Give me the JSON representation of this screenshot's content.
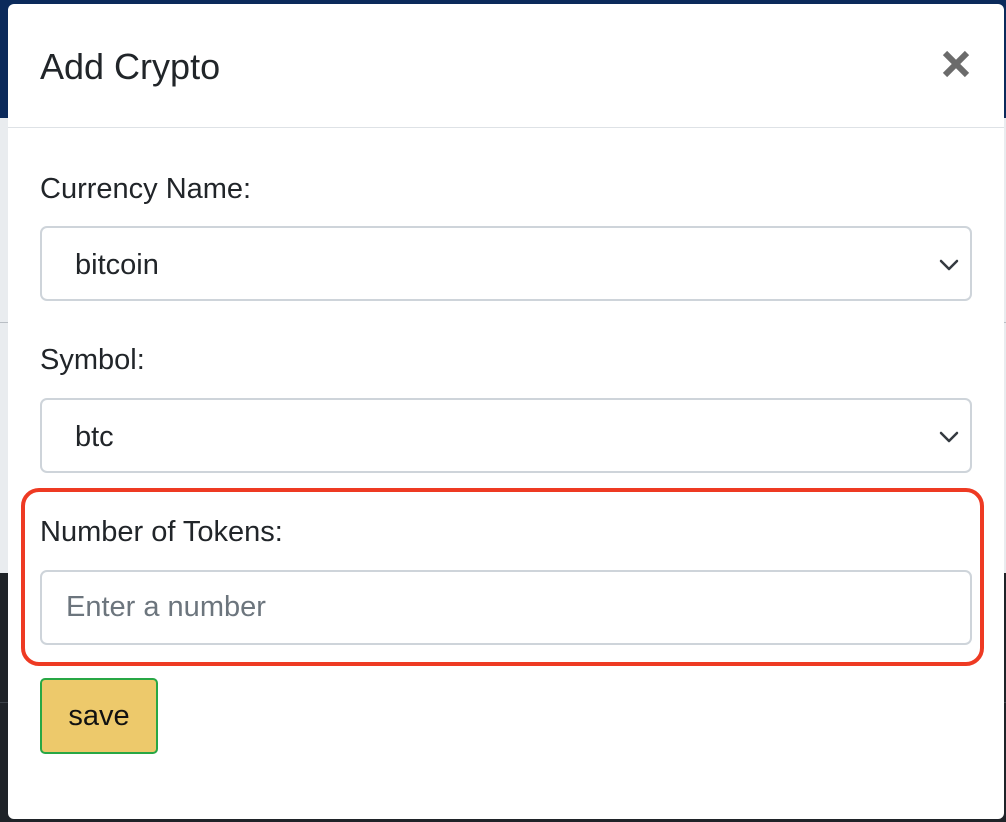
{
  "modal": {
    "title": "Add Crypto",
    "close_icon": "close-icon"
  },
  "form": {
    "currency_name": {
      "label": "Currency Name:",
      "selected": "bitcoin"
    },
    "symbol": {
      "label": "Symbol:",
      "selected": "btc"
    },
    "tokens": {
      "label": "Number of Tokens:",
      "placeholder": "Enter a number",
      "value": ""
    },
    "save_label": "save"
  },
  "colors": {
    "highlight": "#ee3a23",
    "save_button_bg": "#edc96b",
    "save_button_border": "#28a745",
    "input_border": "#ced4da"
  }
}
